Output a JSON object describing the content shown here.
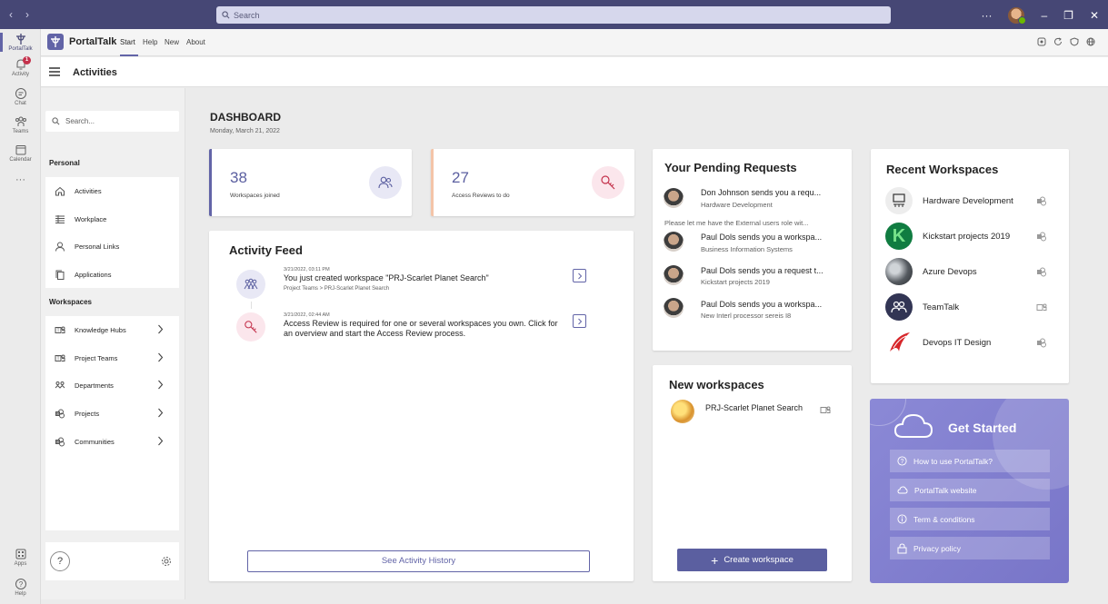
{
  "titlebar": {
    "search_placeholder": "Search",
    "more": "···"
  },
  "rail": {
    "items": [
      {
        "label": "PortalTalk"
      },
      {
        "label": "Activity",
        "badge": "1"
      },
      {
        "label": "Chat"
      },
      {
        "label": "Teams"
      },
      {
        "label": "Calendar"
      },
      {
        "label": "···"
      },
      {
        "label": "Apps"
      },
      {
        "label": "Help"
      }
    ]
  },
  "app": {
    "name": "PortalTalk",
    "tabs": [
      "Start",
      "Help",
      "New",
      "About"
    ]
  },
  "page": {
    "title": "Activities"
  },
  "sidebar": {
    "search_placeholder": "Search...",
    "personal_heading": "Personal",
    "personal_items": [
      {
        "label": "Activities",
        "icon": "home-icon"
      },
      {
        "label": "Workplace",
        "icon": "grid-icon"
      },
      {
        "label": "Personal Links",
        "icon": "person-icon"
      },
      {
        "label": "Applications",
        "icon": "copy-icon"
      }
    ],
    "workspaces_heading": "Workspaces",
    "workspace_items": [
      {
        "label": "Knowledge Hubs",
        "icon": "teams-icon"
      },
      {
        "label": "Project Teams",
        "icon": "teams-icon"
      },
      {
        "label": "Departments",
        "icon": "people-icon"
      },
      {
        "label": "Projects",
        "icon": "sharepoint-icon"
      },
      {
        "label": "Communities",
        "icon": "sharepoint-icon"
      }
    ],
    "help": "?"
  },
  "dashboard": {
    "title": "DASHBOARD",
    "date": "Monday, March 21, 2022",
    "stats": [
      {
        "value": "38",
        "label": "Workspaces joined",
        "accent": "#6264a7"
      },
      {
        "value": "27",
        "label": "Access Reviews to do",
        "accent": "#f4c4a8"
      }
    ]
  },
  "feed": {
    "title": "Activity Feed",
    "items": [
      {
        "time": "3/21/2022, 03:11 PM",
        "text": "You just created workspace \"PRJ-Scarlet Planet Search\"",
        "sub": "Project Teams > PRJ-Scarlet Planet Search"
      },
      {
        "time": "3/21/2022, 02:44 AM",
        "text": "Access Review is required for one or several workspaces you own. Click for an overview and start the Access Review process.",
        "sub": ""
      }
    ],
    "history_button": "See Activity History"
  },
  "pending": {
    "title": "Your Pending Requests",
    "items": [
      {
        "name": "Don Johnson sends you a requ...",
        "sub": "Hardware Development"
      },
      {
        "name": "Paul Dols sends you a workspa...",
        "sub": "Business Information Systems"
      },
      {
        "name": "Paul Dols sends you a request t...",
        "sub": "Kickstart projects 2019"
      },
      {
        "name": "Paul Dols sends you a workspa...",
        "sub": "New Interl processor sereis I8"
      }
    ],
    "note": "Please let me have the External users role wit..."
  },
  "new_workspaces": {
    "title": "New workspaces",
    "items": [
      {
        "name": "PRJ-Scarlet Planet Search"
      }
    ],
    "create_button": "Create workspace"
  },
  "recent": {
    "title": "Recent Workspaces",
    "items": [
      {
        "name": "Hardware Development"
      },
      {
        "name": "Kickstart projects 2019"
      },
      {
        "name": "Azure Devops"
      },
      {
        "name": "TeamTalk"
      },
      {
        "name": "Devops IT Design"
      }
    ]
  },
  "get_started": {
    "title": "Get Started",
    "links": [
      {
        "label": "How to use PortalTalk?"
      },
      {
        "label": "PortalTalk website"
      },
      {
        "label": "Term & conditions"
      },
      {
        "label": "Privacy policy"
      }
    ]
  },
  "colors": {
    "brand": "#6264a7",
    "titlebar": "#464775",
    "accent_red": "#c4314b"
  }
}
